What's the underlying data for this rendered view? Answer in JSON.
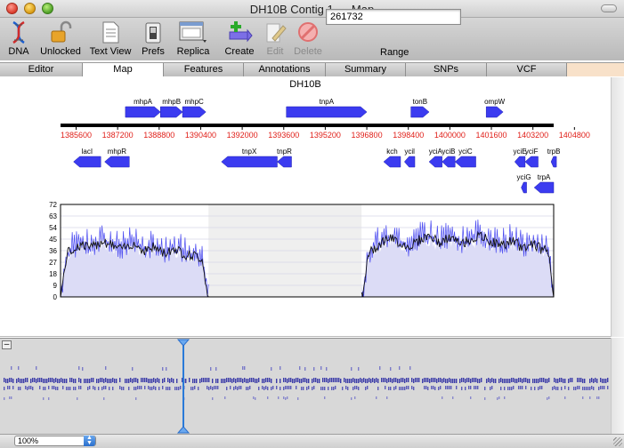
{
  "window": {
    "title": "DH10B Contig 1 — Map"
  },
  "toolbar": {
    "dna": "DNA",
    "unlocked": "Unlocked",
    "text_view": "Text View",
    "prefs": "Prefs",
    "replica": "Replica",
    "create": "Create",
    "edit": "Edit",
    "delete": "Delete",
    "range_value": "261732",
    "range_label": "Range"
  },
  "tabs": [
    "Editor",
    "Map",
    "Features",
    "Annotations",
    "Summary",
    "SNPs",
    "VCF"
  ],
  "active_tab": "Map",
  "map": {
    "title": "DH10B",
    "axis_min": 1385000,
    "axis_max": 1404000,
    "ruler_ticks": [
      "1385600",
      "1387200",
      "1388800",
      "1390400",
      "1392000",
      "1393600",
      "1395200",
      "1396800",
      "1398400",
      "1400000",
      "1401600",
      "1403200",
      "1404800"
    ],
    "ruler_tick_values": [
      1385600,
      1387200,
      1388800,
      1390400,
      1392000,
      1393600,
      1395200,
      1396800,
      1398400,
      1400000,
      1401600,
      1403200,
      1404800
    ],
    "genes_top": [
      {
        "name": "mhpA",
        "start": 1387500,
        "end": 1388850
      },
      {
        "name": "mhpB",
        "start": 1388850,
        "end": 1389700
      },
      {
        "name": "mhpC",
        "start": 1389700,
        "end": 1390600
      },
      {
        "name": "tnpA",
        "start": 1393700,
        "end": 1396800
      },
      {
        "name": "tonB",
        "start": 1398500,
        "end": 1399200
      },
      {
        "name": "ompW",
        "start": 1401400,
        "end": 1402050
      }
    ],
    "genes_bottom": [
      {
        "name": "lacI",
        "start": 1385500,
        "end": 1386550
      },
      {
        "name": "mhpR",
        "start": 1386700,
        "end": 1387650
      },
      {
        "name": "tnpX",
        "start": 1391200,
        "end": 1393350
      },
      {
        "name": "tnpR",
        "start": 1393350,
        "end": 1393900
      },
      {
        "name": "kch",
        "start": 1397450,
        "end": 1398100
      },
      {
        "name": "ycil",
        "start": 1398250,
        "end": 1398650
      },
      {
        "name": "yciA",
        "start": 1399200,
        "end": 1399700
      },
      {
        "name": "yciB",
        "start": 1399700,
        "end": 1400200
      },
      {
        "name": "yciC",
        "start": 1400200,
        "end": 1401000
      },
      {
        "name": "yciE",
        "start": 1402500,
        "end": 1402900
      },
      {
        "name": "yciF",
        "start": 1402900,
        "end": 1403400
      },
      {
        "name": "trpB",
        "start": 1403900,
        "end": 1404100
      }
    ],
    "genes_bottom2": [
      {
        "name": "yciG",
        "start": 1402750,
        "end": 1402950
      },
      {
        "name": "trpA",
        "start": 1403250,
        "end": 1404000
      }
    ]
  },
  "chart_data": {
    "type": "area",
    "yticks": [
      0,
      9,
      18,
      27,
      36,
      45,
      54,
      63,
      72
    ],
    "ylim": [
      0,
      72
    ],
    "xlim": [
      1385000,
      1404000
    ],
    "gap_region": [
      1390700,
      1396600
    ],
    "series": [
      {
        "x": [
          1385000,
          1385400,
          1385800,
          1386200,
          1386600,
          1387000,
          1387400,
          1387800,
          1388200,
          1388600,
          1389000,
          1389400,
          1389800,
          1390200,
          1390600,
          1390700,
          1396600,
          1396800,
          1397200,
          1397600,
          1398000,
          1398400,
          1398800,
          1399200,
          1399600,
          1400000,
          1400400,
          1400800,
          1401200,
          1401600,
          1402000,
          1402400,
          1402800,
          1403200,
          1403600,
          1404000
        ],
        "values": [
          30,
          36,
          41,
          38,
          44,
          40,
          37,
          42,
          36,
          39,
          34,
          38,
          33,
          32,
          28,
          0,
          0,
          32,
          40,
          46,
          43,
          39,
          44,
          48,
          42,
          46,
          41,
          45,
          47,
          43,
          40,
          44,
          38,
          42,
          36,
          45
        ]
      }
    ]
  },
  "zoom": {
    "value": "100%"
  }
}
